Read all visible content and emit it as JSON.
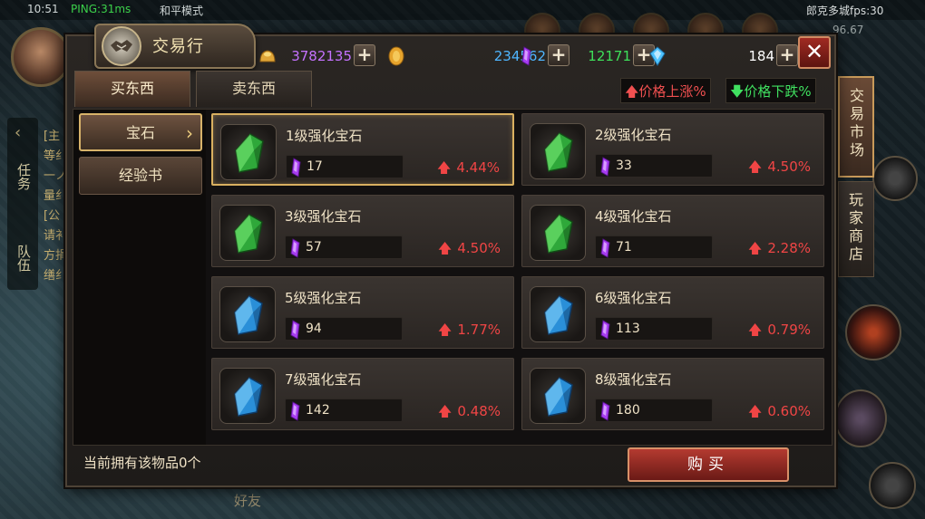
{
  "hud": {
    "time": "10:51",
    "ping": "PING:31ms",
    "mode": "和平模式",
    "city_fps": "郎克多城fps:30",
    "fps2": "96.67",
    "left_tab_task": "任务",
    "left_tab_team": "队伍",
    "chat_fragment": "[主 等纟 一ノ 量纟 [公 请衤 方捐 缮纟",
    "friends": "好友"
  },
  "panel": {
    "title": "交易行",
    "close_label": "✕",
    "currencies": [
      {
        "icon": "gold-ingot-icon",
        "value": "3782135",
        "color": "#c572ff",
        "plus": "+"
      },
      {
        "icon": "gold-coin-icon",
        "value": "234562",
        "color": "#4fb6ff",
        "plus": "+"
      },
      {
        "icon": "purple-crystal-icon",
        "value": "12171",
        "color": "#3ee05a",
        "plus": "+"
      },
      {
        "icon": "blue-diamond-icon",
        "value": "184",
        "color": "#ffffff",
        "plus": "+"
      }
    ],
    "tabs": {
      "buy": "买东西",
      "sell": "卖东西"
    },
    "legend": {
      "up": "价格上涨%",
      "down": "价格下跌%"
    },
    "categories": [
      {
        "label": "宝石",
        "active": true
      },
      {
        "label": "经验书",
        "active": false
      }
    ],
    "items": [
      {
        "name": "1级强化宝石",
        "price": "17",
        "change": "4.44%",
        "gem": "green"
      },
      {
        "name": "2级强化宝石",
        "price": "33",
        "change": "4.50%",
        "gem": "green"
      },
      {
        "name": "3级强化宝石",
        "price": "57",
        "change": "4.50%",
        "gem": "green"
      },
      {
        "name": "4级强化宝石",
        "price": "71",
        "change": "2.28%",
        "gem": "green"
      },
      {
        "name": "5级强化宝石",
        "price": "94",
        "change": "1.77%",
        "gem": "blue"
      },
      {
        "name": "6级强化宝石",
        "price": "113",
        "change": "0.79%",
        "gem": "blue"
      },
      {
        "name": "7级强化宝石",
        "price": "142",
        "change": "0.48%",
        "gem": "blue"
      },
      {
        "name": "8级强化宝石",
        "price": "180",
        "change": "0.60%",
        "gem": "blue"
      }
    ],
    "owned_text": "当前拥有该物品0个",
    "buy_button": "购买",
    "side_tabs": {
      "market": "交易市场",
      "shop": "玩家商店"
    }
  },
  "colors": {
    "price_up": "#f04545",
    "price_down": "#40e060",
    "accent_gold": "#d9b060"
  }
}
